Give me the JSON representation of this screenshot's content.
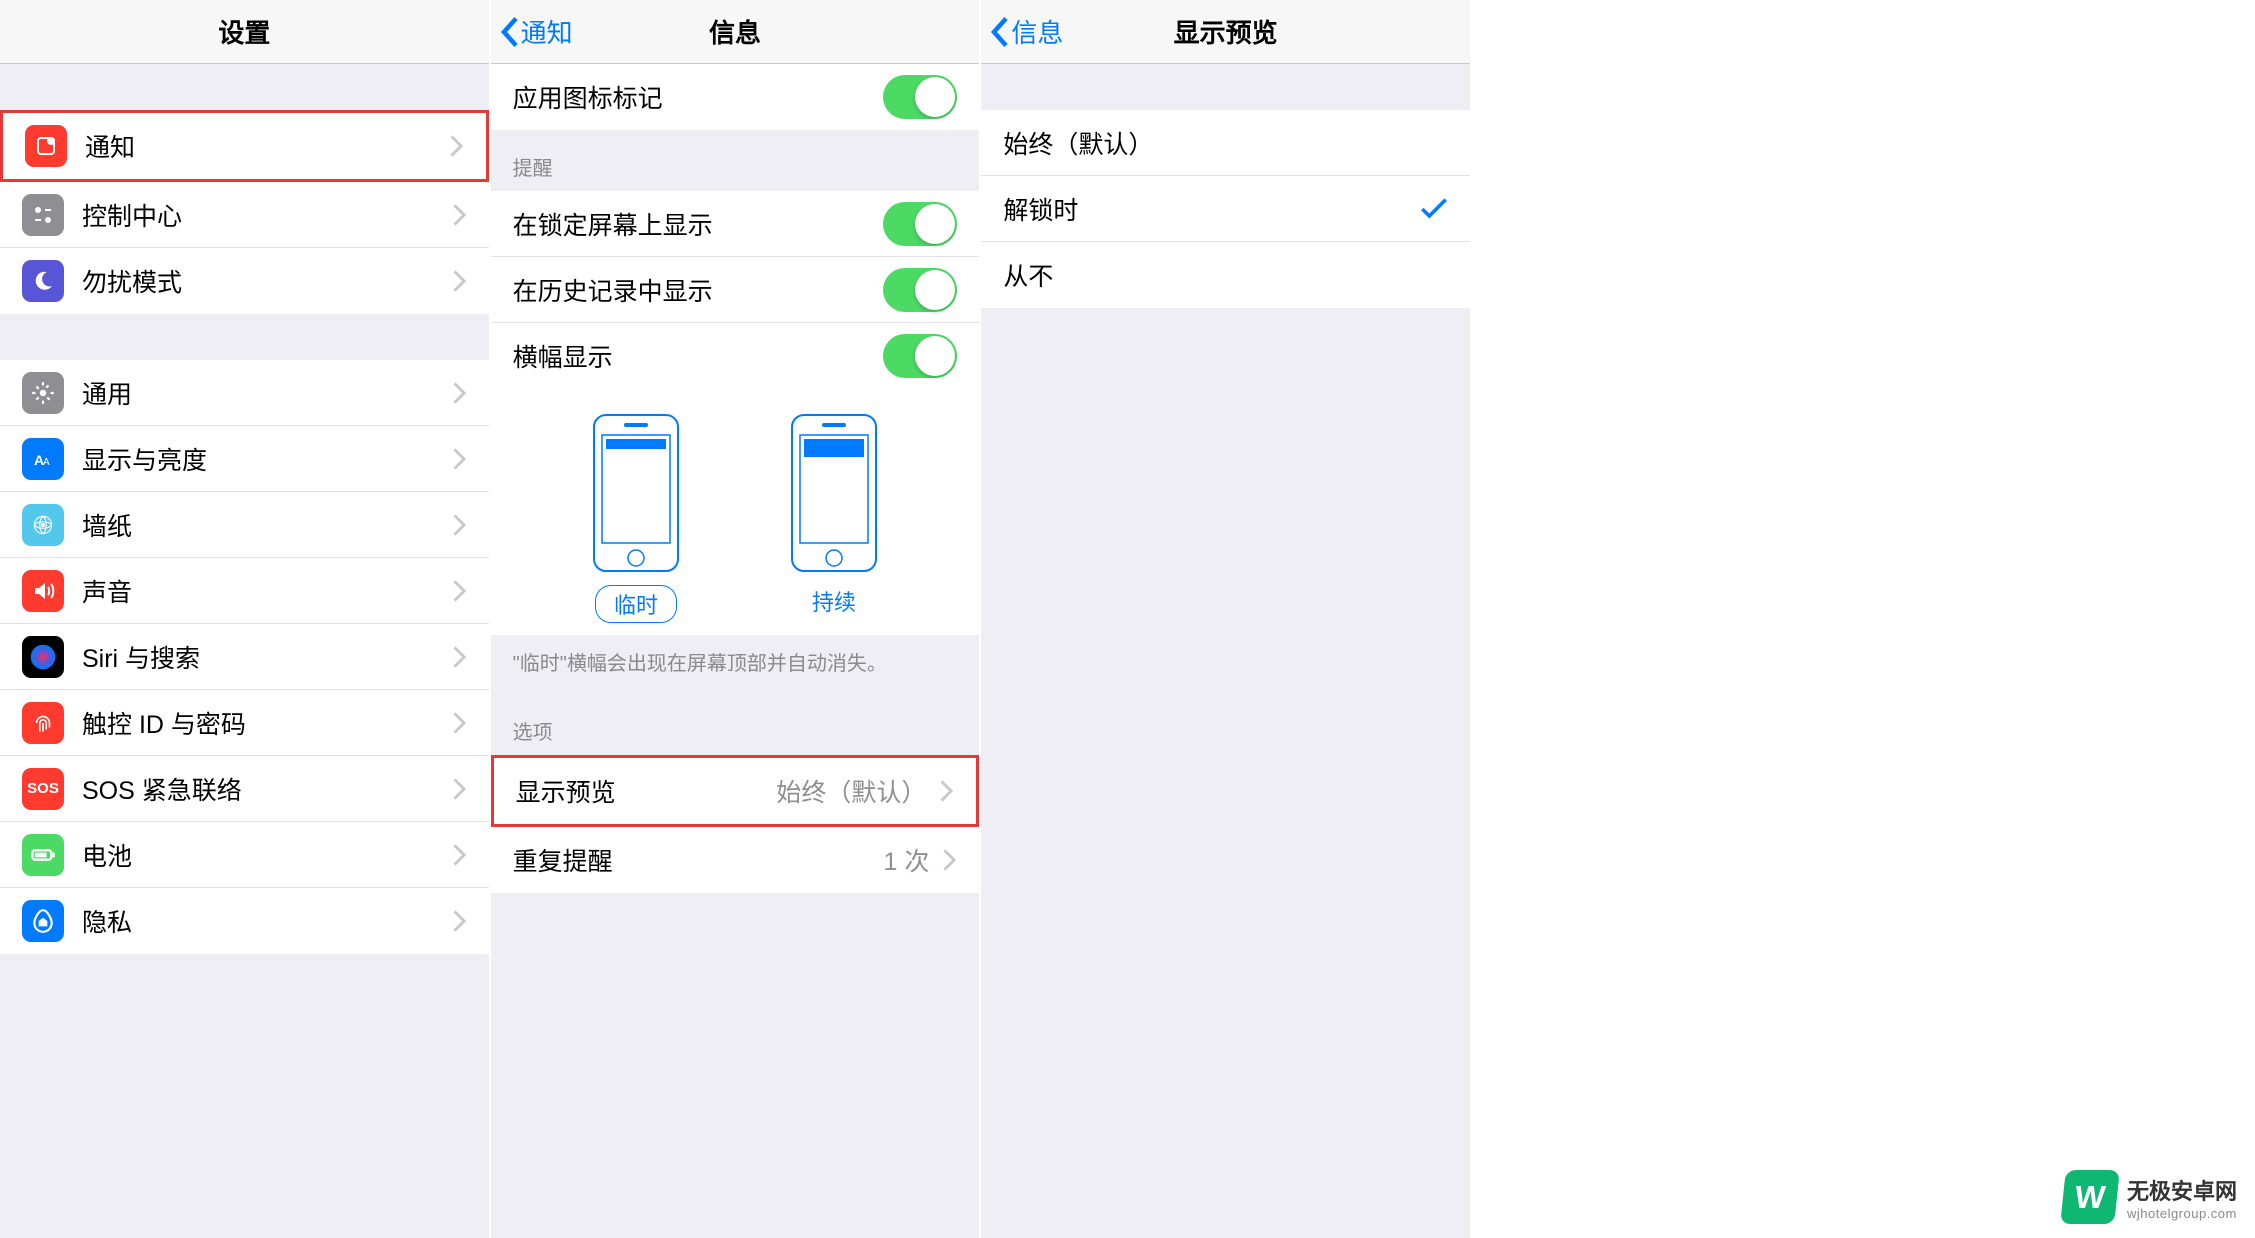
{
  "screen1": {
    "title": "设置",
    "groupA": [
      {
        "icon": "notif",
        "color": "#ff3b30",
        "label": "通知",
        "hl": true
      },
      {
        "icon": "control",
        "color": "#8e8e93",
        "label": "控制中心"
      },
      {
        "icon": "dnd",
        "color": "#5856d6",
        "label": "勿扰模式"
      }
    ],
    "groupB": [
      {
        "icon": "general",
        "color": "#8e8e93",
        "label": "通用"
      },
      {
        "icon": "display",
        "color": "#007aff",
        "label": "显示与亮度"
      },
      {
        "icon": "wallpaper",
        "color": "#54c7ec",
        "label": "墙纸"
      },
      {
        "icon": "sound",
        "color": "#ff3b30",
        "label": "声音"
      },
      {
        "icon": "siri",
        "color": "#000",
        "label": "Siri 与搜索"
      },
      {
        "icon": "touchid",
        "color": "#ff3b30",
        "label": "触控 ID 与密码"
      },
      {
        "icon": "sos",
        "color": "#ff3b30",
        "label": "SOS 紧急联络"
      },
      {
        "icon": "battery",
        "color": "#4cd964",
        "label": "电池"
      },
      {
        "icon": "privacy",
        "color": "#007aff",
        "label": "隐私"
      }
    ]
  },
  "screen2": {
    "back": "通知",
    "title": "信息",
    "badge": "应用图标标记",
    "section_alert": "提醒",
    "alerts": [
      {
        "label": "在锁定屏幕上显示"
      },
      {
        "label": "在历史记录中显示"
      },
      {
        "label": "横幅显示"
      }
    ],
    "banner_temp": "临时",
    "banner_persist": "持续",
    "desc": "\"临时\"横幅会出现在屏幕顶部并自动消失。",
    "section_opt": "选项",
    "preview_label": "显示预览",
    "preview_value": "始终（默认）",
    "repeat_label": "重复提醒",
    "repeat_value": "1 次"
  },
  "screen3": {
    "back": "信息",
    "title": "显示预览",
    "options": [
      {
        "label": "始终（默认）",
        "sel": false
      },
      {
        "label": "解锁时",
        "sel": true
      },
      {
        "label": "从不",
        "sel": false
      }
    ]
  },
  "watermark": {
    "name": "无极安卓网",
    "url": "wjhotelgroup.com"
  }
}
